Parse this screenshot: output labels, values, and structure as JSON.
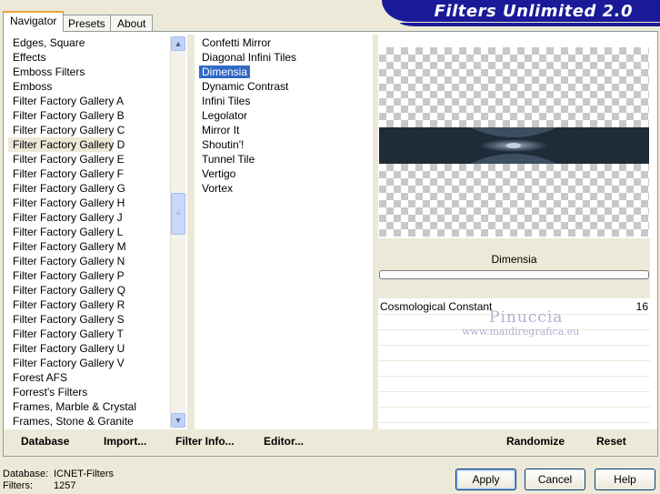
{
  "tabs": [
    "Navigator",
    "Presets",
    "About"
  ],
  "app_title": "Filters Unlimited 2.0",
  "categories": [
    "Edges, Square",
    "Effects",
    "Emboss Filters",
    "Emboss",
    "Filter Factory Gallery A",
    "Filter Factory Gallery B",
    "Filter Factory Gallery C",
    "Filter Factory Gallery D",
    "Filter Factory Gallery E",
    "Filter Factory Gallery F",
    "Filter Factory Gallery G",
    "Filter Factory Gallery H",
    "Filter Factory Gallery J",
    "Filter Factory Gallery L",
    "Filter Factory Gallery M",
    "Filter Factory Gallery N",
    "Filter Factory Gallery P",
    "Filter Factory Gallery Q",
    "Filter Factory Gallery R",
    "Filter Factory Gallery S",
    "Filter Factory Gallery T",
    "Filter Factory Gallery U",
    "Filter Factory Gallery V",
    "Forest AFS",
    "Forrest's Filters",
    "Frames, Marble & Crystal",
    "Frames, Stone & Granite"
  ],
  "selected_category": "Filter Factory Gallery D",
  "filters": [
    "Confetti Mirror",
    "Diagonal Infini Tiles",
    "Dimensia",
    "Dynamic Contrast",
    "Infini Tiles",
    "Legolator",
    "Mirror It",
    "Shoutin'!",
    "Tunnel Tile",
    "Vertigo",
    "Vortex"
  ],
  "selected_filter": "Dimensia",
  "preview": {
    "filter_name": "Dimensia"
  },
  "parameters": [
    {
      "label": "Cosmological Constant",
      "value": "16"
    }
  ],
  "watermark": {
    "line1": "Pinuccia",
    "line2": "www.maidiregrafica.eu"
  },
  "toolbar": {
    "database": "Database",
    "import": "Import...",
    "filter_info": "Filter Info...",
    "editor": "Editor...",
    "randomize": "Randomize",
    "reset": "Reset"
  },
  "status": {
    "database_label": "Database:",
    "database_value": "ICNET-Filters",
    "filters_label": "Filters:",
    "filters_value": "1257"
  },
  "buttons": {
    "apply": "Apply",
    "cancel": "Cancel",
    "help": "Help"
  },
  "colors": {
    "banner": "#1a1a98",
    "selection": "#316ac5",
    "band_dark": "#1e2c38"
  }
}
